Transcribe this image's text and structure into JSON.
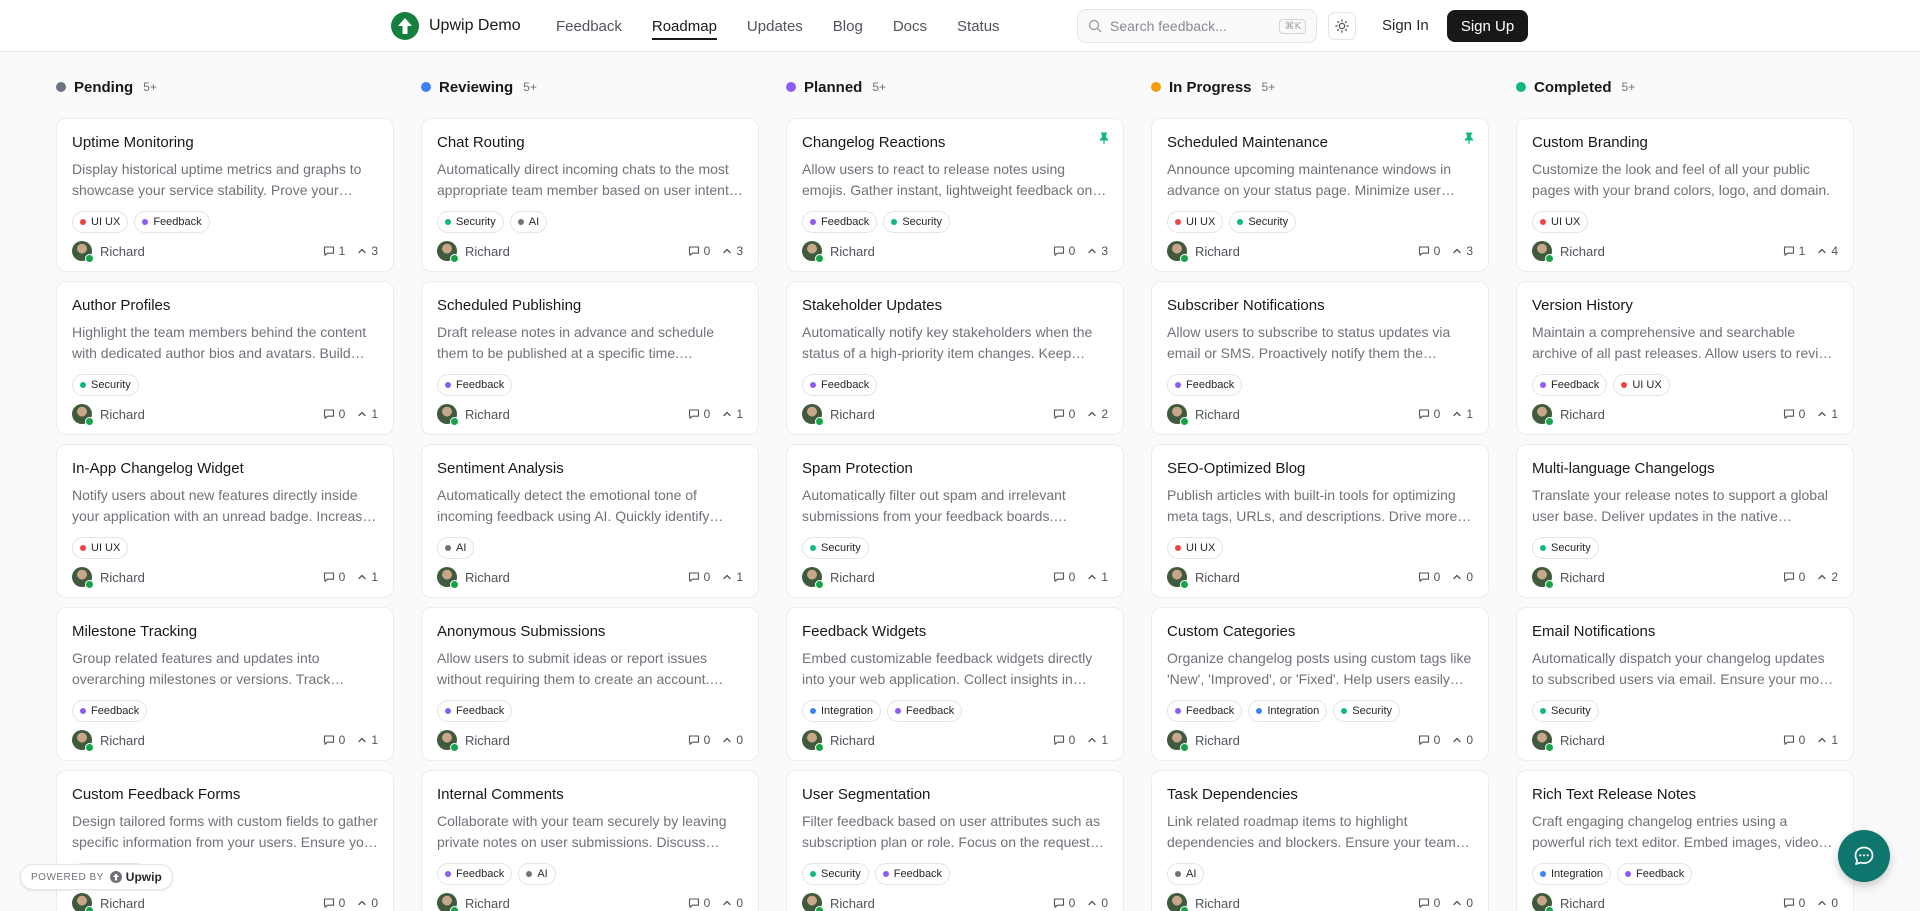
{
  "app": {
    "name": "Upwip Demo"
  },
  "nav": {
    "items": [
      {
        "label": "Feedback",
        "active": false
      },
      {
        "label": "Roadmap",
        "active": true
      },
      {
        "label": "Updates",
        "active": false
      },
      {
        "label": "Blog",
        "active": false
      },
      {
        "label": "Docs",
        "active": false
      },
      {
        "label": "Status",
        "active": false
      }
    ]
  },
  "search": {
    "placeholder": "Search feedback...",
    "shortcut": "⌘K"
  },
  "auth": {
    "signin": "Sign In",
    "signup": "Sign Up"
  },
  "tag_colors": {
    "UI UX": "#ef4444",
    "Feedback": "#8b5cf6",
    "Security": "#10b981",
    "AI": "#71717a",
    "Integration": "#3b82f6"
  },
  "columns": [
    {
      "name": "Pending",
      "color": "#6b7280",
      "count": "5+",
      "cards": [
        {
          "title": "Uptime Monitoring",
          "desc": "Display historical uptime metrics and graphs to showcase your service stability. Prove your reliability to customers.",
          "tags": [
            "UI UX",
            "Feedback"
          ],
          "author": "Richard",
          "comments": "1",
          "votes": "3",
          "pinned": false
        },
        {
          "title": "Author Profiles",
          "desc": "Highlight the team members behind the content with dedicated author bios and avatars. Build trust with readers.",
          "tags": [
            "Security"
          ],
          "author": "Richard",
          "comments": "0",
          "votes": "1",
          "pinned": false
        },
        {
          "title": "In-App Changelog Widget",
          "desc": "Notify users about new features directly inside your application with an unread badge. Increase adoption.",
          "tags": [
            "UI UX"
          ],
          "author": "Richard",
          "comments": "0",
          "votes": "1",
          "pinned": false
        },
        {
          "title": "Milestone Tracking",
          "desc": "Group related features and updates into overarching milestones or versions. Track progress over time.",
          "tags": [
            "Feedback"
          ],
          "author": "Richard",
          "comments": "0",
          "votes": "1",
          "pinned": false
        },
        {
          "title": "Custom Feedback Forms",
          "desc": "Design tailored forms with custom fields to gather specific information from your users. Ensure you get details.",
          "tags": [
            "Feedback"
          ],
          "author": "Richard",
          "comments": "0",
          "votes": "0",
          "pinned": false
        }
      ]
    },
    {
      "name": "Reviewing",
      "color": "#3b82f6",
      "count": "5+",
      "cards": [
        {
          "title": "Chat Routing",
          "desc": "Automatically direct incoming chats to the most appropriate team member based on user intent. Resolve faster.",
          "tags": [
            "Security",
            "AI"
          ],
          "author": "Richard",
          "comments": "0",
          "votes": "3",
          "pinned": false
        },
        {
          "title": "Scheduled Publishing",
          "desc": "Draft release notes in advance and schedule them to be published at a specific time. Coordinate launches.",
          "tags": [
            "Feedback"
          ],
          "author": "Richard",
          "comments": "0",
          "votes": "1",
          "pinned": false
        },
        {
          "title": "Sentiment Analysis",
          "desc": "Automatically detect the emotional tone of incoming feedback using AI. Quickly identify frustrated users.",
          "tags": [
            "AI"
          ],
          "author": "Richard",
          "comments": "0",
          "votes": "1",
          "pinned": false
        },
        {
          "title": "Anonymous Submissions",
          "desc": "Allow users to submit ideas or report issues without requiring them to create an account. Lower friction.",
          "tags": [
            "Feedback"
          ],
          "author": "Richard",
          "comments": "0",
          "votes": "0",
          "pinned": false
        },
        {
          "title": "Internal Comments",
          "desc": "Collaborate with your team securely by leaving private notes on user submissions. Discuss priorities.",
          "tags": [
            "Feedback",
            "AI"
          ],
          "author": "Richard",
          "comments": "0",
          "votes": "0",
          "pinned": false
        }
      ]
    },
    {
      "name": "Planned",
      "color": "#8b5cf6",
      "count": "5+",
      "cards": [
        {
          "title": "Changelog Reactions",
          "desc": "Allow users to react to release notes using emojis. Gather instant, lightweight feedback on how you ship.",
          "tags": [
            "Feedback",
            "Security"
          ],
          "author": "Richard",
          "comments": "0",
          "votes": "3",
          "pinned": true
        },
        {
          "title": "Stakeholder Updates",
          "desc": "Automatically notify key stakeholders when the status of a high-priority item changes. Keep everyone aligned.",
          "tags": [
            "Feedback"
          ],
          "author": "Richard",
          "comments": "0",
          "votes": "2",
          "pinned": false
        },
        {
          "title": "Spam Protection",
          "desc": "Automatically filter out spam and irrelevant submissions from your feedback boards. Maintain quality.",
          "tags": [
            "Security"
          ],
          "author": "Richard",
          "comments": "0",
          "votes": "1",
          "pinned": false
        },
        {
          "title": "Feedback Widgets",
          "desc": "Embed customizable feedback widgets directly into your web application. Collect insights in context.",
          "tags": [
            "Integration",
            "Feedback"
          ],
          "author": "Richard",
          "comments": "0",
          "votes": "1",
          "pinned": false
        },
        {
          "title": "User Segmentation",
          "desc": "Filter feedback based on user attributes such as subscription plan or role. Focus on the requests that matter.",
          "tags": [
            "Security",
            "Feedback"
          ],
          "author": "Richard",
          "comments": "0",
          "votes": "0",
          "pinned": false
        }
      ]
    },
    {
      "name": "In Progress",
      "color": "#f59e0b",
      "count": "5+",
      "cards": [
        {
          "title": "Scheduled Maintenance",
          "desc": "Announce upcoming maintenance windows in advance on your status page. Minimize user disruption.",
          "tags": [
            "UI UX",
            "Security"
          ],
          "author": "Richard",
          "comments": "0",
          "votes": "3",
          "pinned": true
        },
        {
          "title": "Subscriber Notifications",
          "desc": "Allow users to subscribe to status updates via email or SMS. Proactively notify them the moment issues occur.",
          "tags": [
            "Feedback"
          ],
          "author": "Richard",
          "comments": "0",
          "votes": "1",
          "pinned": false
        },
        {
          "title": "SEO-Optimized Blog",
          "desc": "Publish articles with built-in tools for optimizing meta tags, URLs, and descriptions. Drive more traffic.",
          "tags": [
            "UI UX"
          ],
          "author": "Richard",
          "comments": "0",
          "votes": "0",
          "pinned": false
        },
        {
          "title": "Custom Categories",
          "desc": "Organize changelog posts using custom tags like 'New', 'Improved', or 'Fixed'. Help users easily scan.",
          "tags": [
            "Feedback",
            "Integration",
            "Security"
          ],
          "author": "Richard",
          "comments": "0",
          "votes": "0",
          "pinned": false
        },
        {
          "title": "Task Dependencies",
          "desc": "Link related roadmap items to highlight dependencies and blockers. Ensure your team stays on track.",
          "tags": [
            "AI"
          ],
          "author": "Richard",
          "comments": "0",
          "votes": "0",
          "pinned": false
        }
      ]
    },
    {
      "name": "Completed",
      "color": "#10b981",
      "count": "5+",
      "cards": [
        {
          "title": "Custom Branding",
          "desc": "Customize the look and feel of all your public pages with your brand colors, logo, and domain.",
          "tags": [
            "UI UX"
          ],
          "author": "Richard",
          "comments": "1",
          "votes": "4",
          "pinned": false
        },
        {
          "title": "Version History",
          "desc": "Maintain a comprehensive and searchable archive of all past releases. Allow users to review the history.",
          "tags": [
            "Feedback",
            "UI UX"
          ],
          "author": "Richard",
          "comments": "0",
          "votes": "1",
          "pinned": false
        },
        {
          "title": "Multi-language Changelogs",
          "desc": "Translate your release notes to support a global user base. Deliver updates in the native language.",
          "tags": [
            "Security"
          ],
          "author": "Richard",
          "comments": "0",
          "votes": "2",
          "pinned": false
        },
        {
          "title": "Email Notifications",
          "desc": "Automatically dispatch your changelog updates to subscribed users via email. Ensure your most loyal users know.",
          "tags": [
            "Security"
          ],
          "author": "Richard",
          "comments": "0",
          "votes": "1",
          "pinned": false
        },
        {
          "title": "Rich Text Release Notes",
          "desc": "Craft engaging changelog entries using a powerful rich text editor. Embed images, videos, and more.",
          "tags": [
            "Integration",
            "Feedback"
          ],
          "author": "Richard",
          "comments": "0",
          "votes": "0",
          "pinned": false
        }
      ]
    }
  ],
  "footer": {
    "powered_by": "POWERED BY",
    "brand": "Upwip"
  }
}
